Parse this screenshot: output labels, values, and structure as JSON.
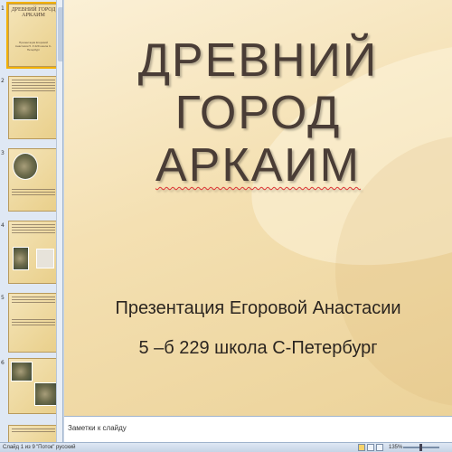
{
  "slide": {
    "title_line1": "ДРЕВНИЙ ГОРОД",
    "title_line2": "АРКАИМ",
    "subtitle_line1": "Презентация Егоровой Анастасии",
    "subtitle_line2": "5 –б 229 школа С-Петербург"
  },
  "thumbnails": [
    {
      "number": "1",
      "title": "ДРЕВНИЙ ГОРОД АРКАИМ",
      "subtitle": "Презентация Егоровой Анастасии 5 -б 229 школа С-Петербург"
    },
    {
      "number": "2"
    },
    {
      "number": "3"
    },
    {
      "number": "4"
    },
    {
      "number": "5"
    },
    {
      "number": "6"
    }
  ],
  "notes": {
    "placeholder": "Заметки к слайду"
  },
  "status": {
    "slide_info": "Слайд 1 из 9",
    "theme": "\"Поток\"",
    "language": "русский",
    "zoom": "135%"
  }
}
